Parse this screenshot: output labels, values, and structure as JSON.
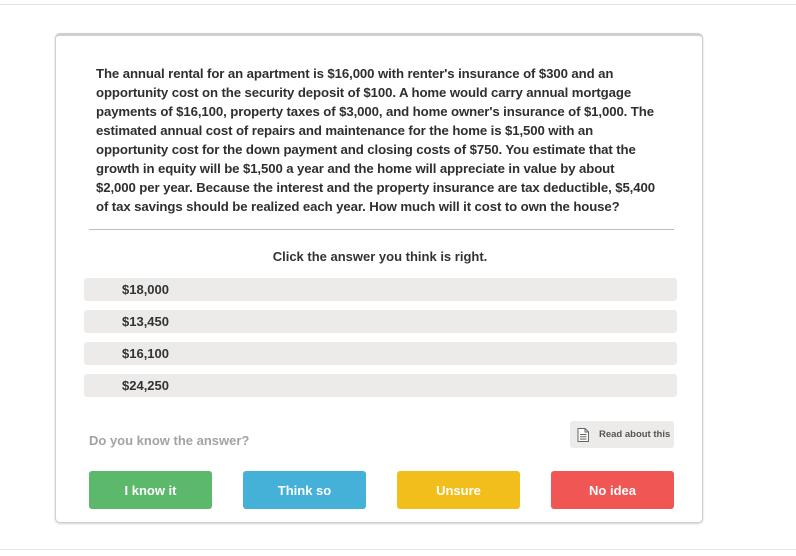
{
  "question": {
    "text": "The annual rental for an apartment is $16,000 with renter's insurance of $300 and an opportunity cost on the security deposit of $100. A home would carry annual mortgage payments of $16,100, property taxes of $3,000, and home owner's insurance of $1,000. The estimated annual cost of repairs and maintenance for the home is $1,500 with an opportunity cost for the down payment and closing costs of $750. You estimate that the growth in equity will be $1,500 a year and the home will appreciate in value by about $2,000 per year. Because the interest and the property insurance are tax deductible, $5,400 of tax savings should be realized each year. How much will it cost to own the house?"
  },
  "prompt": "Click the answer you think is right.",
  "options": [
    "$18,000",
    "$13,450",
    "$16,100",
    "$24,250"
  ],
  "confidence": {
    "label": "Do you know the answer?",
    "read_about_label": "Read about this",
    "read_about_icon": "document-icon",
    "buttons": {
      "know": "I know it",
      "think": "Think so",
      "unsure": "Unsure",
      "no_idea": "No idea"
    }
  },
  "colors": {
    "know": "#5cb86a",
    "think": "#45b0d8",
    "unsure": "#f2be1b",
    "no_idea": "#ef5654",
    "option_bg": "#ecebea"
  }
}
